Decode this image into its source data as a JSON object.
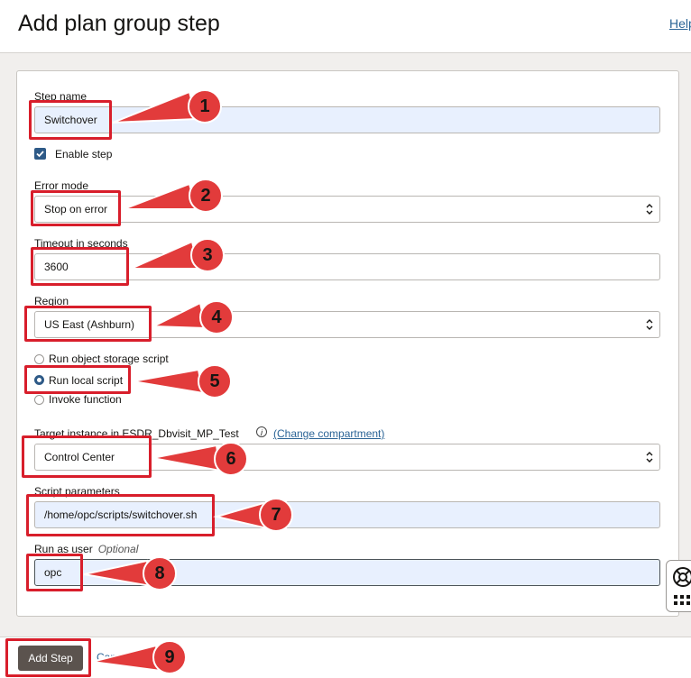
{
  "header": {
    "title": "Add plan group step",
    "help_label": "Help"
  },
  "form": {
    "step_name": {
      "label": "Step name",
      "value": "Switchover"
    },
    "enable_step": {
      "label": "Enable step",
      "checked": true
    },
    "error_mode": {
      "label": "Error mode",
      "value": "Stop on error"
    },
    "timeout": {
      "label": "Timeout in seconds",
      "value": "3600"
    },
    "region": {
      "label": "Region",
      "value": "US East (Ashburn)"
    },
    "script_type": {
      "options": [
        "Run object storage script",
        "Run local script",
        "Invoke function"
      ],
      "selected": "Run local script"
    },
    "target_instance": {
      "label": "Target instance in ESDR_Dbvisit_MP_Test",
      "change_link": "(Change compartment)",
      "value": "Control Center"
    },
    "script_parameters": {
      "label": "Script parameters",
      "value": "/home/opc/scripts/switchover.sh"
    },
    "run_as_user": {
      "label": "Run as user",
      "optional": "Optional",
      "value": "opc"
    }
  },
  "footer": {
    "add_label": "Add Step",
    "cancel_label": "Cancel"
  },
  "callouts": [
    "1",
    "2",
    "3",
    "4",
    "5",
    "6",
    "7",
    "8",
    "9"
  ],
  "colors": {
    "callout": "#e23b3b",
    "highlight": "#d81e2b",
    "accent": "#2e5a87"
  }
}
